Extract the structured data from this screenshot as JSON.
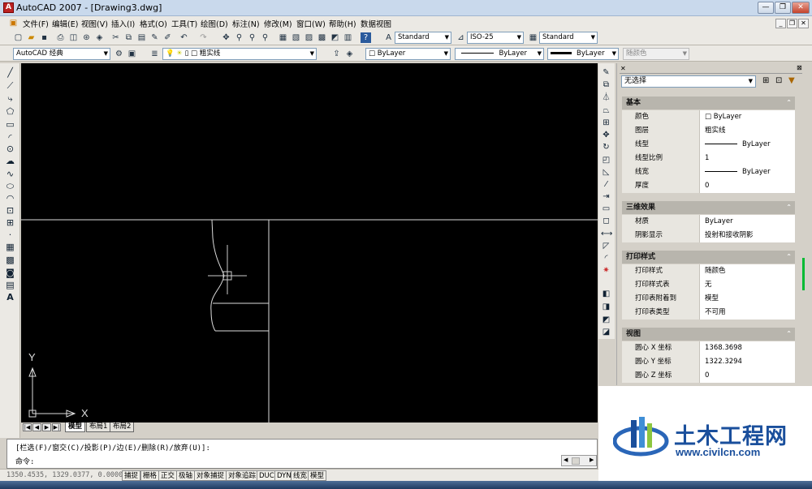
{
  "window": {
    "title": "AutoCAD 2007 - [Drawing3.dwg]"
  },
  "menu": [
    "文件(F)",
    "编辑(E)",
    "视图(V)",
    "插入(I)",
    "格式(O)",
    "工具(T)",
    "绘图(D)",
    "标注(N)",
    "修改(M)",
    "窗口(W)",
    "帮助(H)",
    "数据视图"
  ],
  "toolbar": {
    "text_style": "Standard",
    "dim_style": "ISO-25",
    "table_style": "Standard",
    "workspace": "AutoCAD 经典",
    "layer_name": "粗实线",
    "color": "ByLayer",
    "linetype": "ByLayer",
    "lineweight": "ByLayer",
    "plot_style": "随颜色"
  },
  "canvas": {
    "ucs_x_label": "X",
    "ucs_y_label": "Y"
  },
  "layout_tabs": [
    "模型",
    "布局1",
    "布局2"
  ],
  "command": {
    "history": "[栏选(F)/窗交(C)/投影(P)/边(E)/删除(R)/放弃(U)]:",
    "prompt": "命令:"
  },
  "status": {
    "coords": "1350.4535, 1329.0377, 0.0000",
    "buttons": [
      "捕捉",
      "栅格",
      "正交",
      "极轴",
      "对象捕捉",
      "对象追踪",
      "DUCS",
      "DYN",
      "线宽",
      "模型"
    ]
  },
  "properties": {
    "selection": "无选择",
    "sections": [
      {
        "title": "基本",
        "rows": [
          {
            "name": "颜色",
            "value": "ByLayer",
            "swatch": true
          },
          {
            "name": "图层",
            "value": "粗实线"
          },
          {
            "name": "线型",
            "value": "ByLayer",
            "line": true
          },
          {
            "name": "线型比例",
            "value": "1"
          },
          {
            "name": "线宽",
            "value": "ByLayer",
            "line": true
          },
          {
            "name": "厚度",
            "value": "0"
          }
        ]
      },
      {
        "title": "三维效果",
        "rows": [
          {
            "name": "材质",
            "value": "ByLayer"
          },
          {
            "name": "阴影显示",
            "value": "投射和接收阴影"
          }
        ]
      },
      {
        "title": "打印样式",
        "rows": [
          {
            "name": "打印样式",
            "value": "随颜色"
          },
          {
            "name": "打印样式表",
            "value": "无"
          },
          {
            "name": "打印表附着到",
            "value": "模型"
          },
          {
            "name": "打印表类型",
            "value": "不可用"
          }
        ]
      },
      {
        "title": "视图",
        "rows": [
          {
            "name": "圆心 X 坐标",
            "value": "1368.3698"
          },
          {
            "name": "圆心 Y 坐标",
            "value": "1322.3294"
          },
          {
            "name": "圆心 Z 坐标",
            "value": "0"
          }
        ]
      }
    ]
  },
  "watermark": {
    "name": "土木工程网",
    "url": "www.civilcn.com",
    "brand_color": "#1a4f9c"
  }
}
